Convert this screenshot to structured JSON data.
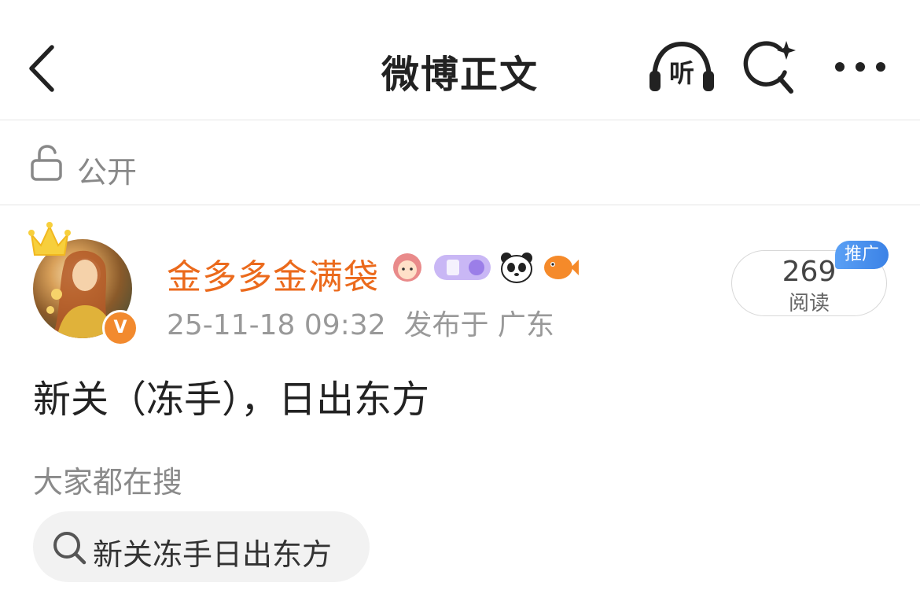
{
  "header": {
    "title": "微博正文",
    "listen_label": "听",
    "icons": {
      "back": "chevron-left-icon",
      "listen": "headphones-icon",
      "search": "search-sparkle-icon",
      "more": "more-dots-icon"
    }
  },
  "visibility": {
    "label": "公开",
    "icon": "lock-open-icon"
  },
  "post": {
    "author": {
      "name": "金多多金满袋",
      "verified_mark": "V"
    },
    "meta": "25-11-18 09:32  发布于 广东",
    "reads": {
      "count": "269",
      "label": "阅读",
      "promo_tag": "推广"
    },
    "text": "新关（冻手），日出东方"
  },
  "suggestions": {
    "title": "大家都在搜",
    "items": [
      {
        "text": "新关冻手日出东方",
        "icon": "search-icon"
      }
    ]
  },
  "colors": {
    "username": "#eb6a1c",
    "verified": "#f28a2e",
    "promo": "#3b82e6",
    "pill_bg": "#f2f2f2"
  }
}
